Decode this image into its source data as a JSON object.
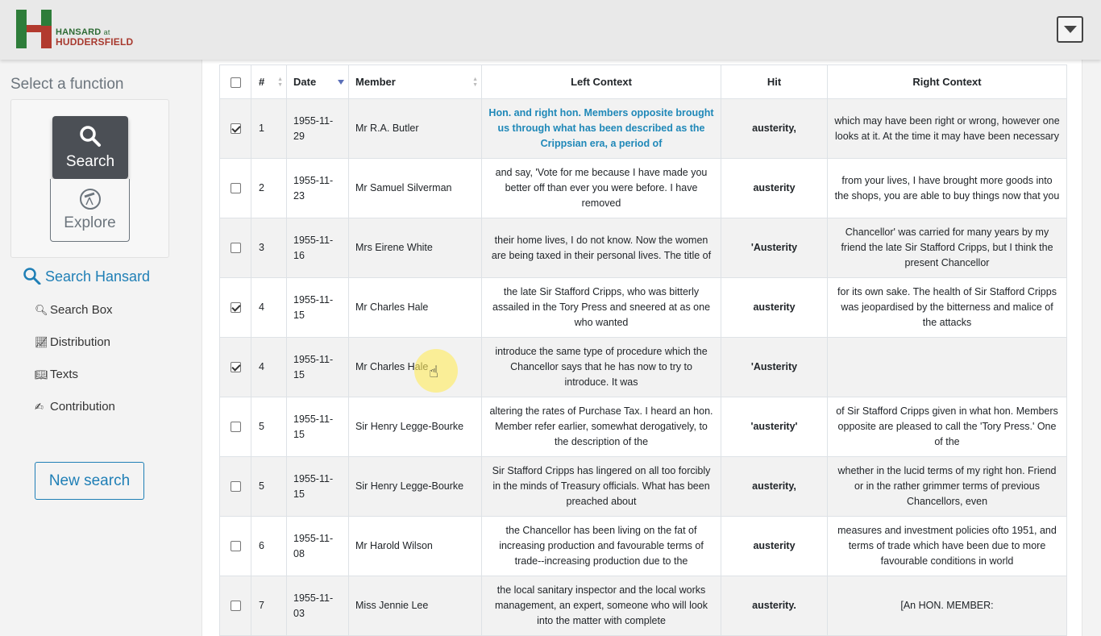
{
  "header": {
    "logo_line1": "HANSARD",
    "logo_at": "at",
    "logo_line2": "HUDDERSFIELD"
  },
  "sidebar": {
    "select_function": "Select a function",
    "search_label": "Search",
    "explore_label": "Explore",
    "section_title": "Search Hansard",
    "items": [
      {
        "label": "Search Box",
        "icon": "search-icon"
      },
      {
        "label": "Distribution",
        "icon": "chart-line-icon"
      },
      {
        "label": "Texts",
        "icon": "book-icon"
      },
      {
        "label": "Contribution",
        "icon": "contribution-icon"
      }
    ],
    "new_search": "New search"
  },
  "table": {
    "headers": {
      "num": "#",
      "date": "Date",
      "member": "Member",
      "left": "Left Context",
      "hit": "Hit",
      "right": "Right Context"
    },
    "rows": [
      {
        "checked": true,
        "num": "1",
        "date": "1955-11-29",
        "member": "Mr R.A. Butler",
        "left": "Hon. and right hon. Members opposite brought us through what has been described as the Crippsian era, a period of",
        "hit": "austerity,",
        "right": "which may have been right or wrong, however one looks at it. At the time it may have been necessary"
      },
      {
        "checked": false,
        "num": "2",
        "date": "1955-11-23",
        "member": "Mr Samuel Silverman",
        "left": "and say, 'Vote for me because I have made you better off than ever you were before. I have removed",
        "hit": "austerity",
        "right": "from your lives, I have brought more goods into the shops, you are able to buy things now that you"
      },
      {
        "checked": false,
        "num": "3",
        "date": "1955-11-16",
        "member": "Mrs Eirene White",
        "left": "their home lives, I do not know. Now the women are being taxed in their personal lives. The title of",
        "hit": "'Austerity",
        "right": "Chancellor' was carried for many years by my friend the late Sir Stafford Cripps, but I think the present Chancellor"
      },
      {
        "checked": true,
        "num": "4",
        "date": "1955-11-15",
        "member": "Mr Charles Hale",
        "left": "the late Sir Stafford Cripps, who was bitterly assailed in the Tory Press and sneered at as one who wanted",
        "hit": "austerity",
        "right": "for its own sake. The health of Sir Stafford Cripps was jeopardised by the bitterness and malice of the attacks"
      },
      {
        "checked": true,
        "num": "4",
        "date": "1955-11-15",
        "member": "Mr Charles Hale",
        "left": "introduce the same type of procedure which the Chancellor says that he has now to try to introduce. It was",
        "hit": "'Austerity",
        "right": ""
      },
      {
        "checked": false,
        "num": "5",
        "date": "1955-11-15",
        "member": "Sir Henry Legge-Bourke",
        "left": "altering the rates of Purchase Tax. I heard an hon. Member refer earlier, somewhat derogatively, to the description of the",
        "hit": "'austerity'",
        "right": "of Sir Stafford Cripps given in what hon. Members opposite are pleased to call the 'Tory Press.' One of the"
      },
      {
        "checked": false,
        "num": "5",
        "date": "1955-11-15",
        "member": "Sir Henry Legge-Bourke",
        "left": "Sir Stafford Cripps has lingered on all too forcibly in the minds of Treasury officials. What has been preached about",
        "hit": "austerity,",
        "right": "whether in the lucid terms of my right hon. Friend or in the rather grimmer terms of previous Chancellors, even"
      },
      {
        "checked": false,
        "num": "6",
        "date": "1955-11-08",
        "member": "Mr Harold Wilson",
        "left": "the Chancellor has been living on the fat of increasing production and favourable terms of trade--increasing production due to the",
        "hit": "austerity",
        "right": "measures and investment policies ofto 1951, and terms of trade which have been due to more favourable conditions in world"
      },
      {
        "checked": false,
        "num": "7",
        "date": "1955-11-03",
        "member": "Miss Jennie Lee",
        "left": "the local sanitary inspector and the local works management, an expert, someone who will look into the matter with complete",
        "hit": "austerity.",
        "right": "[An HON. MEMBER:"
      }
    ]
  }
}
